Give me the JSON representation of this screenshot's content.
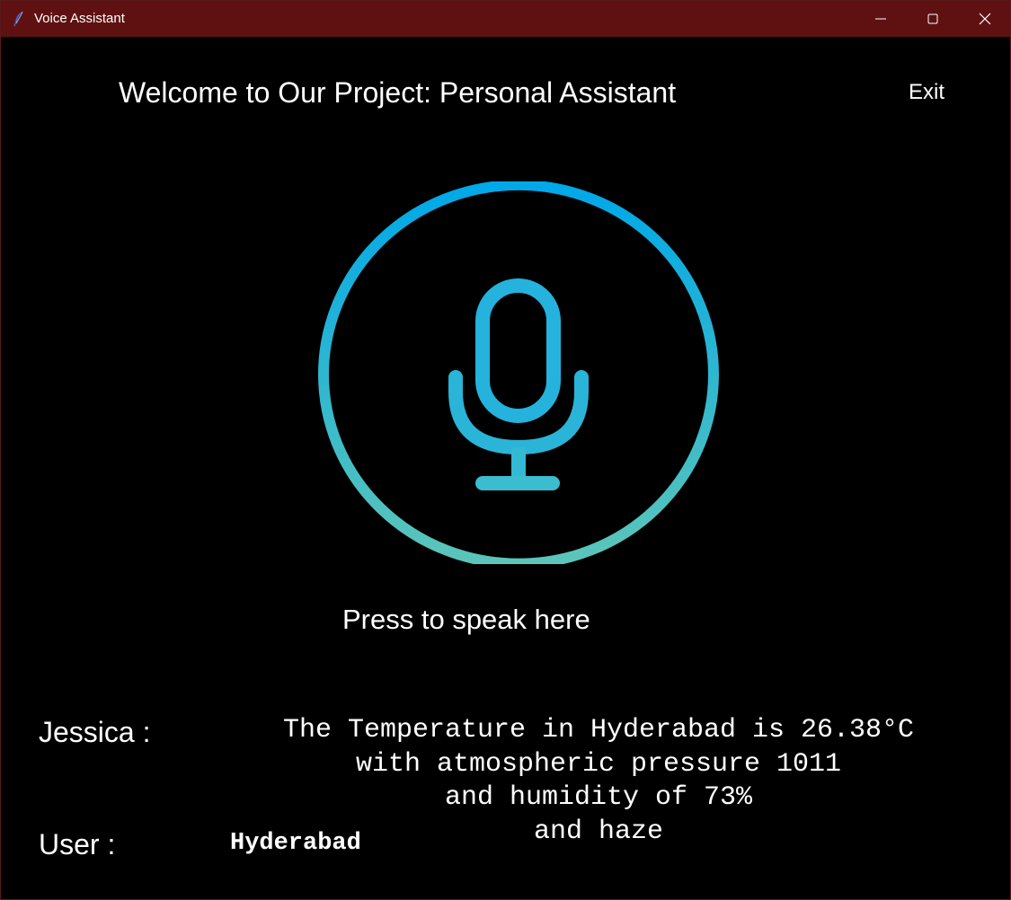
{
  "window": {
    "title": "Voice Assistant",
    "titlebar_color": "#5f1111",
    "icon": "feather-icon",
    "controls": [
      "minimize-icon",
      "maximize-icon",
      "close-icon"
    ]
  },
  "header": {
    "welcome_text": "Welcome to Our Project: Personal Assistant",
    "exit_label": "Exit"
  },
  "mic": {
    "icon": "microphone-icon",
    "gradient_top": "#00a8e8",
    "gradient_bottom": "#5cc5b9",
    "press_label": "Press to speak here"
  },
  "conversation": {
    "assistant_label": "Jessica :",
    "assistant_lines": [
      "The Temperature in Hyderabad is 26.38°C",
      "with atmospheric pressure 1011",
      "and humidity of 73%",
      "and haze"
    ],
    "user_label": "User :",
    "user_text": "Hyderabad"
  }
}
